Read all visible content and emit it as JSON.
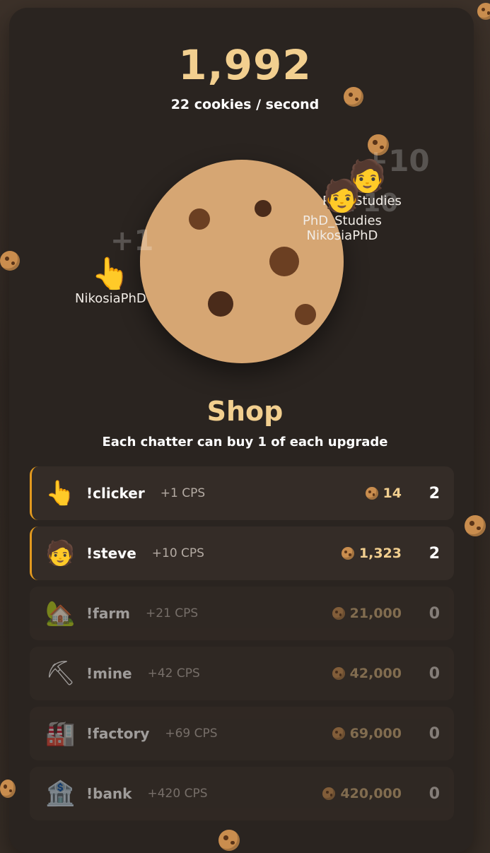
{
  "header": {
    "cookie_count": "1,992",
    "cookies_per_second": "22 cookies / second"
  },
  "floating_users": [
    {
      "name": "NikosiaPhD",
      "icon": "pointing-hand-icon",
      "gain": "+1"
    },
    {
      "name": "PhD_Studies",
      "icon": "steve-face-icon",
      "gain": "+10"
    },
    {
      "name": "NikosiaPhD",
      "icon": "steve-face-icon",
      "gain": "+10"
    },
    {
      "name": "PhD_Studies",
      "icon": "steve-face-icon",
      "gain": ""
    }
  ],
  "shop": {
    "title": "Shop",
    "subtitle": "Each chatter can buy 1 of each upgrade",
    "items": [
      {
        "command": "!clicker",
        "cps": "+1 CPS",
        "price": "14",
        "owned": "2",
        "icon": "pointing-hand-icon",
        "state": "owned"
      },
      {
        "command": "!steve",
        "cps": "+10 CPS",
        "price": "1,323",
        "owned": "2",
        "icon": "steve-face-icon",
        "state": "owned"
      },
      {
        "command": "!farm",
        "cps": "+21 CPS",
        "price": "21,000",
        "owned": "0",
        "icon": "house-icon",
        "state": "locked"
      },
      {
        "command": "!mine",
        "cps": "+42 CPS",
        "price": "42,000",
        "owned": "0",
        "icon": "pickaxe-icon",
        "state": "locked"
      },
      {
        "command": "!factory",
        "cps": "+69 CPS",
        "price": "69,000",
        "owned": "0",
        "icon": "factory-icon",
        "state": "locked"
      },
      {
        "command": "!bank",
        "cps": "+420 CPS",
        "price": "420,000",
        "owned": "0",
        "icon": "bank-icon",
        "state": "locked"
      }
    ]
  },
  "colors": {
    "accent": "#f2cf8f",
    "owned_border": "#e39a1f",
    "panel": "#2a2420",
    "row": "#342c27"
  }
}
